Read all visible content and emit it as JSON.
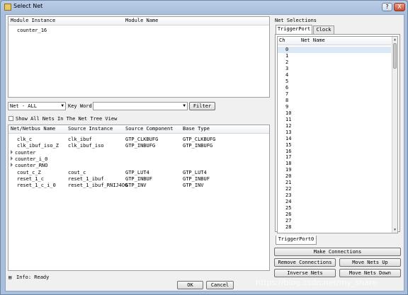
{
  "window": {
    "title": "Select Net",
    "help_label": "?",
    "close_label": "X"
  },
  "instance_table": {
    "headers": [
      "Module Instance",
      "Module Name"
    ],
    "rows": [
      [
        "counter_16",
        ""
      ]
    ]
  },
  "filter_bar": {
    "net_type_value": "Net - ALL",
    "keyword_label": "Key Word:",
    "keyword_value": "",
    "filter_label": "Filter"
  },
  "show_all_nets_label": "Show All Nets In The Net Tree View",
  "net_table": {
    "headers": [
      "Net/Netbus Name",
      "Source Instance",
      "Source Component",
      "Base Type"
    ],
    "rows": [
      {
        "name": "clk_c",
        "expandable": false,
        "source_instance": "clk_ibuf",
        "source_component": "GTP_CLKBUFG",
        "base_type": "GTP_CLKBUFG"
      },
      {
        "name": "clk_ibuf_iso_Z",
        "expandable": false,
        "source_instance": "clk_ibuf_iso",
        "source_component": "GTP_INBUFG",
        "base_type": "GTP_INBUFG"
      },
      {
        "name": "counter",
        "expandable": true,
        "source_instance": "",
        "source_component": "",
        "base_type": ""
      },
      {
        "name": "counter_i_0",
        "expandable": true,
        "source_instance": "",
        "source_component": "",
        "base_type": ""
      },
      {
        "name": "counter_RNO",
        "expandable": true,
        "source_instance": "",
        "source_component": "",
        "base_type": ""
      },
      {
        "name": "cout_c_Z",
        "expandable": false,
        "source_instance": "cout_c",
        "source_component": "GTP_LUT4",
        "base_type": "GTP_LUT4"
      },
      {
        "name": "reset_1_c",
        "expandable": false,
        "source_instance": "reset_1_ibuf",
        "source_component": "GTP_INBUF",
        "base_type": "GTP_INBUF"
      },
      {
        "name": "reset_1_c_i_0",
        "expandable": false,
        "source_instance": "reset_1_ibuf_RNIJ4O6",
        "source_component": "GTP_INV",
        "base_type": "GTP_INV"
      }
    ]
  },
  "status": {
    "text": "Info: Ready"
  },
  "footer": {
    "ok_label": "OK",
    "cancel_label": "Cancel"
  },
  "net_selections": {
    "title": "Net Selections",
    "tabs": [
      "TriggerPort",
      "Clock"
    ],
    "active_tab": "TriggerPort",
    "headers": [
      "Ch",
      "Net Name"
    ],
    "channels": [
      "0",
      "1",
      "2",
      "3",
      "4",
      "5",
      "6",
      "7",
      "8",
      "9",
      "10",
      "11",
      "12",
      "13",
      "14",
      "15",
      "16",
      "17",
      "18",
      "19",
      "20",
      "21",
      "22",
      "23",
      "24",
      "25",
      "26",
      "27",
      "28"
    ],
    "bottom_tab": "TriggerPort0"
  },
  "actions": {
    "make_connections": "Make Connections",
    "remove_connections": "Remove Connections",
    "move_nets_up": "Move Nets Up",
    "inverse_nets": "Inverse Nets",
    "move_nets_down": "Move Nets Down"
  },
  "watermark": "https://blog.csdn.net/my_share",
  "colors": {
    "title_gradient_top": "#b9cde6",
    "client_bg": "#f0f0f0",
    "close_button": "#c44d33",
    "selected_row": "#dde8f6"
  }
}
